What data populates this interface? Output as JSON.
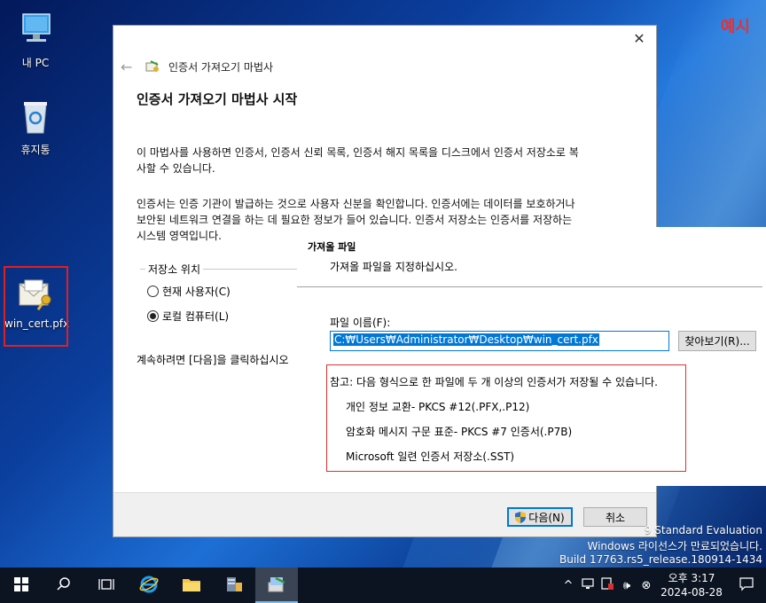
{
  "desktop": {
    "icons": [
      {
        "label": "내 PC"
      },
      {
        "label": "휴지통"
      },
      {
        "label": "win_cert.pfx"
      }
    ],
    "example_tag": "예시",
    "watermark": {
      "line1": "9 Standard Evaluation",
      "line2": "Windows 라이선스가 만료되었습니다.",
      "line3": "Build 17763.rs5_release.180914-1434"
    }
  },
  "wizard": {
    "nav_title": "인증서 가져오기 마법사",
    "heading": "인증서 가져오기 마법사 시작",
    "para1": "이 마법사를 사용하면 인증서, 인증서 신뢰 목록, 인증서 해지 목록을 디스크에서 인증서 저장소로 복사할 수 있습니다.",
    "para2": "인증서는 인증 기관이 발급하는 것으로 사용자 신분을 확인합니다. 인증서에는 데이터를 보호하거나 보안된 네트워크 연결을 하는 데 필요한 정보가 들어 있습니다. 인증서 저장소는 인증서를 저장하는 시스템 영역입니다.",
    "storage_legend": "저장소 위치",
    "radio_current_user": "현재 사용자(C)",
    "radio_local_machine": "로컬 컴퓨터(L)",
    "continue_text": "계속하려면 [다음]을 클릭하십시오",
    "next_button": "다음(N)",
    "cancel_button": "취소"
  },
  "file_panel": {
    "title": "가져올 파일",
    "subtitle": "가져올 파일을 지정하십시오.",
    "file_label": "파일 이름(F):",
    "file_value": "C:₩Users₩Administrator₩Desktop₩win_cert.pfx",
    "browse_button": "찾아보기(R)...",
    "note_header": "참고: 다음 형식으로 한 파일에 두 개 이상의 인증서가 저장될 수 있습니다.",
    "note_items": [
      "개인 정보 교환- PKCS #12(.PFX,.P12)",
      "암호화 메시지 구문 표준- PKCS #7 인증서(.P7B)",
      "Microsoft 일련 인증서 저장소(.SST)"
    ]
  },
  "taskbar": {
    "time": "오후 3:17",
    "date": "2024-08-28"
  },
  "colors": {
    "accent": "#0078d7",
    "highlight_red": "#e02020",
    "taskbar": "#0c1422"
  }
}
